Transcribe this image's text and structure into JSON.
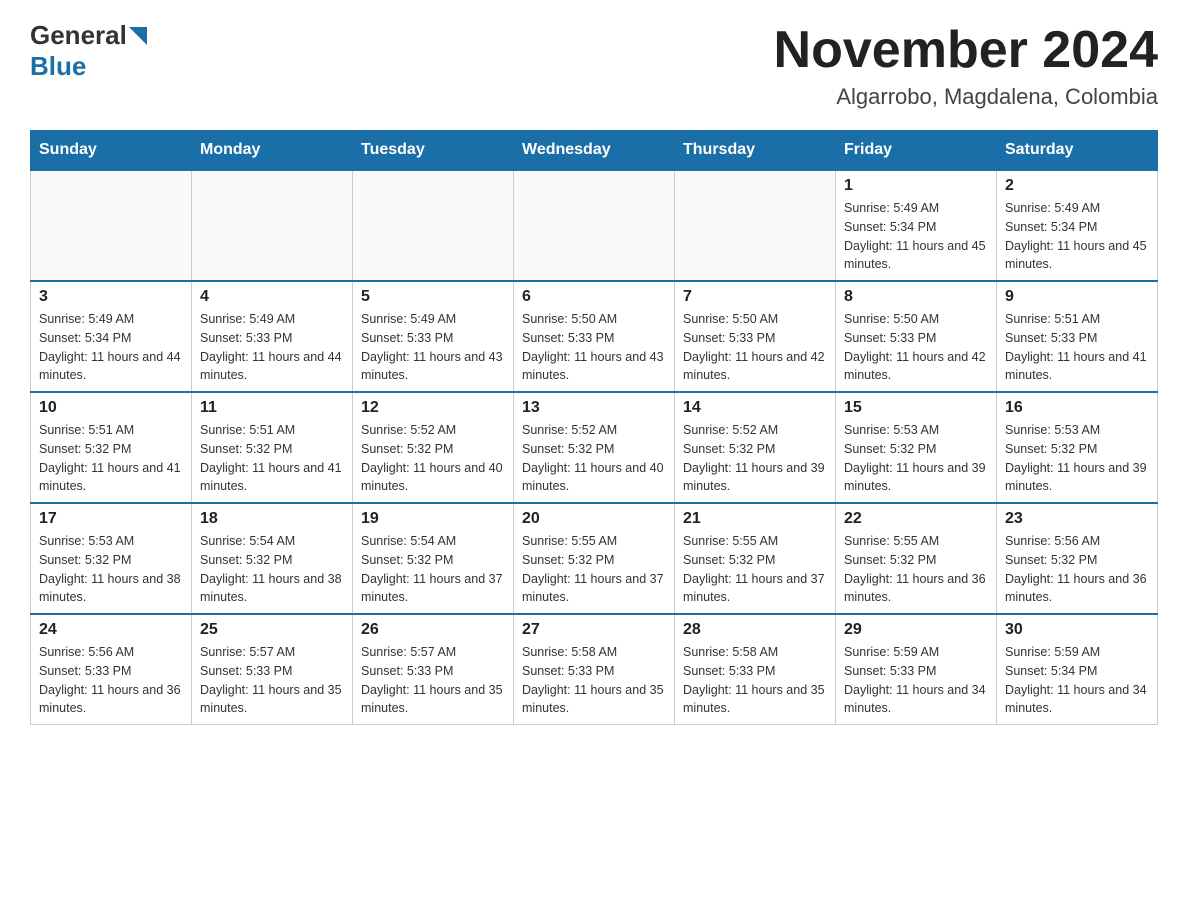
{
  "header": {
    "logo_general": "General",
    "logo_blue": "Blue",
    "month_title": "November 2024",
    "location": "Algarrobo, Magdalena, Colombia"
  },
  "days_of_week": [
    "Sunday",
    "Monday",
    "Tuesday",
    "Wednesday",
    "Thursday",
    "Friday",
    "Saturday"
  ],
  "weeks": [
    [
      {
        "day": "",
        "info": ""
      },
      {
        "day": "",
        "info": ""
      },
      {
        "day": "",
        "info": ""
      },
      {
        "day": "",
        "info": ""
      },
      {
        "day": "",
        "info": ""
      },
      {
        "day": "1",
        "info": "Sunrise: 5:49 AM\nSunset: 5:34 PM\nDaylight: 11 hours and 45 minutes."
      },
      {
        "day": "2",
        "info": "Sunrise: 5:49 AM\nSunset: 5:34 PM\nDaylight: 11 hours and 45 minutes."
      }
    ],
    [
      {
        "day": "3",
        "info": "Sunrise: 5:49 AM\nSunset: 5:34 PM\nDaylight: 11 hours and 44 minutes."
      },
      {
        "day": "4",
        "info": "Sunrise: 5:49 AM\nSunset: 5:33 PM\nDaylight: 11 hours and 44 minutes."
      },
      {
        "day": "5",
        "info": "Sunrise: 5:49 AM\nSunset: 5:33 PM\nDaylight: 11 hours and 43 minutes."
      },
      {
        "day": "6",
        "info": "Sunrise: 5:50 AM\nSunset: 5:33 PM\nDaylight: 11 hours and 43 minutes."
      },
      {
        "day": "7",
        "info": "Sunrise: 5:50 AM\nSunset: 5:33 PM\nDaylight: 11 hours and 42 minutes."
      },
      {
        "day": "8",
        "info": "Sunrise: 5:50 AM\nSunset: 5:33 PM\nDaylight: 11 hours and 42 minutes."
      },
      {
        "day": "9",
        "info": "Sunrise: 5:51 AM\nSunset: 5:33 PM\nDaylight: 11 hours and 41 minutes."
      }
    ],
    [
      {
        "day": "10",
        "info": "Sunrise: 5:51 AM\nSunset: 5:32 PM\nDaylight: 11 hours and 41 minutes."
      },
      {
        "day": "11",
        "info": "Sunrise: 5:51 AM\nSunset: 5:32 PM\nDaylight: 11 hours and 41 minutes."
      },
      {
        "day": "12",
        "info": "Sunrise: 5:52 AM\nSunset: 5:32 PM\nDaylight: 11 hours and 40 minutes."
      },
      {
        "day": "13",
        "info": "Sunrise: 5:52 AM\nSunset: 5:32 PM\nDaylight: 11 hours and 40 minutes."
      },
      {
        "day": "14",
        "info": "Sunrise: 5:52 AM\nSunset: 5:32 PM\nDaylight: 11 hours and 39 minutes."
      },
      {
        "day": "15",
        "info": "Sunrise: 5:53 AM\nSunset: 5:32 PM\nDaylight: 11 hours and 39 minutes."
      },
      {
        "day": "16",
        "info": "Sunrise: 5:53 AM\nSunset: 5:32 PM\nDaylight: 11 hours and 39 minutes."
      }
    ],
    [
      {
        "day": "17",
        "info": "Sunrise: 5:53 AM\nSunset: 5:32 PM\nDaylight: 11 hours and 38 minutes."
      },
      {
        "day": "18",
        "info": "Sunrise: 5:54 AM\nSunset: 5:32 PM\nDaylight: 11 hours and 38 minutes."
      },
      {
        "day": "19",
        "info": "Sunrise: 5:54 AM\nSunset: 5:32 PM\nDaylight: 11 hours and 37 minutes."
      },
      {
        "day": "20",
        "info": "Sunrise: 5:55 AM\nSunset: 5:32 PM\nDaylight: 11 hours and 37 minutes."
      },
      {
        "day": "21",
        "info": "Sunrise: 5:55 AM\nSunset: 5:32 PM\nDaylight: 11 hours and 37 minutes."
      },
      {
        "day": "22",
        "info": "Sunrise: 5:55 AM\nSunset: 5:32 PM\nDaylight: 11 hours and 36 minutes."
      },
      {
        "day": "23",
        "info": "Sunrise: 5:56 AM\nSunset: 5:32 PM\nDaylight: 11 hours and 36 minutes."
      }
    ],
    [
      {
        "day": "24",
        "info": "Sunrise: 5:56 AM\nSunset: 5:33 PM\nDaylight: 11 hours and 36 minutes."
      },
      {
        "day": "25",
        "info": "Sunrise: 5:57 AM\nSunset: 5:33 PM\nDaylight: 11 hours and 35 minutes."
      },
      {
        "day": "26",
        "info": "Sunrise: 5:57 AM\nSunset: 5:33 PM\nDaylight: 11 hours and 35 minutes."
      },
      {
        "day": "27",
        "info": "Sunrise: 5:58 AM\nSunset: 5:33 PM\nDaylight: 11 hours and 35 minutes."
      },
      {
        "day": "28",
        "info": "Sunrise: 5:58 AM\nSunset: 5:33 PM\nDaylight: 11 hours and 35 minutes."
      },
      {
        "day": "29",
        "info": "Sunrise: 5:59 AM\nSunset: 5:33 PM\nDaylight: 11 hours and 34 minutes."
      },
      {
        "day": "30",
        "info": "Sunrise: 5:59 AM\nSunset: 5:34 PM\nDaylight: 11 hours and 34 minutes."
      }
    ]
  ]
}
